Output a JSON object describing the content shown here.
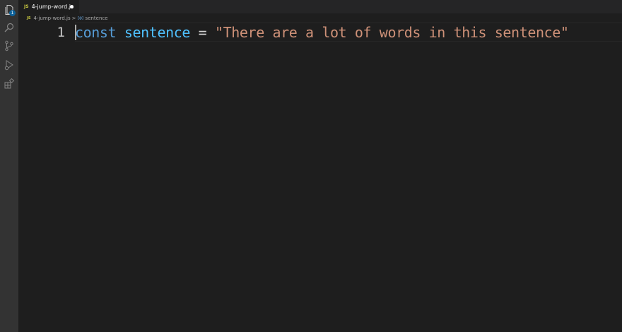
{
  "activity_bar": {
    "explorer_badge": "1",
    "items": [
      "files-icon",
      "search-icon",
      "source-control-icon",
      "run-debug-icon",
      "extensions-icon"
    ]
  },
  "tab": {
    "lang": "JS",
    "filename": "4-jump-word.js"
  },
  "breadcrumb": {
    "lang": "JS",
    "file": "4-jump-word.js",
    "separator": ">",
    "symbol_icon": "[@]",
    "symbol": "sentence"
  },
  "editor": {
    "line_number": "1",
    "tokens": {
      "keyword": "const",
      "space1": " ",
      "variable": "sentence",
      "space2": " ",
      "operator": "=",
      "space3": " ",
      "string": "\"There are a lot of words in this sentence\""
    }
  },
  "colors": {
    "background": "#1e1e1e",
    "activity_bar": "#333333",
    "keyword": "#569cd6",
    "variable": "#4fc1ff",
    "string": "#ce9178",
    "js_badge": "#cbcb41"
  }
}
